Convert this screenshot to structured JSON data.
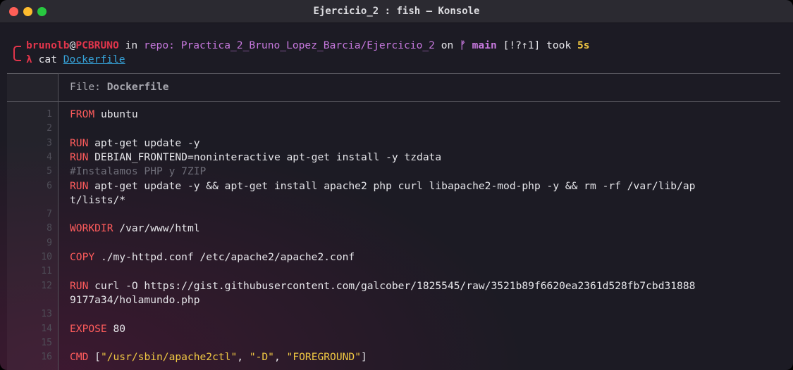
{
  "window": {
    "title": "Ejercicio_2 : fish — Konsole"
  },
  "prompt": {
    "user": "brunolb",
    "at": "@",
    "host": "PCBRUNO",
    "in_text": " in ",
    "repo": "repo: Practica_2_Bruno_Lopez_Barcia/Ejercicio_2",
    "on_text": " on ",
    "branch": "ᚠ main",
    "git_status": " [!?↑1]",
    "took_text": " took ",
    "duration": "5s",
    "lambda": "λ",
    "command": " cat ",
    "argument": "Dockerfile"
  },
  "file_header": {
    "label": "File: ",
    "name": "Dockerfile"
  },
  "lines": [
    {
      "num": "1",
      "parts": [
        {
          "t": "kw",
          "v": "FROM"
        },
        {
          "t": "txt",
          "v": " ubuntu"
        }
      ]
    },
    {
      "num": "2",
      "parts": []
    },
    {
      "num": "3",
      "parts": [
        {
          "t": "kw",
          "v": "RUN"
        },
        {
          "t": "txt",
          "v": " apt-get update -y"
        }
      ]
    },
    {
      "num": "4",
      "parts": [
        {
          "t": "kw",
          "v": "RUN"
        },
        {
          "t": "txt",
          "v": " DEBIAN_FRONTEND=noninteractive apt-get install -y tzdata"
        }
      ]
    },
    {
      "num": "5",
      "parts": [
        {
          "t": "cm",
          "v": "#Instalamos PHP y 7ZIP"
        }
      ]
    },
    {
      "num": "6",
      "parts": [
        {
          "t": "kw",
          "v": "RUN"
        },
        {
          "t": "txt",
          "v": " apt-get update -y && apt-get install apache2 php curl libapache2-mod-php -y && rm -rf /var/lib/ap"
        }
      ]
    },
    {
      "num": "",
      "parts": [
        {
          "t": "txt",
          "v": "t/lists/*"
        }
      ]
    },
    {
      "num": "7",
      "parts": []
    },
    {
      "num": "8",
      "parts": [
        {
          "t": "kw",
          "v": "WORKDIR"
        },
        {
          "t": "txt",
          "v": " /var/www/html"
        }
      ]
    },
    {
      "num": "9",
      "parts": []
    },
    {
      "num": "10",
      "parts": [
        {
          "t": "kw",
          "v": "COPY"
        },
        {
          "t": "txt",
          "v": " ./my-httpd.conf /etc/apache2/apache2.conf"
        }
      ]
    },
    {
      "num": "11",
      "parts": []
    },
    {
      "num": "12",
      "parts": [
        {
          "t": "kw",
          "v": "RUN"
        },
        {
          "t": "txt",
          "v": " curl -O https://gist.githubusercontent.com/galcober/1825545/raw/3521b89f6620ea2361d528fb7cbd31888"
        }
      ]
    },
    {
      "num": "",
      "parts": [
        {
          "t": "txt",
          "v": "9177a34/holamundo.php"
        }
      ]
    },
    {
      "num": "13",
      "parts": []
    },
    {
      "num": "14",
      "parts": [
        {
          "t": "kw",
          "v": "EXPOSE"
        },
        {
          "t": "txt",
          "v": " 80"
        }
      ]
    },
    {
      "num": "15",
      "parts": []
    },
    {
      "num": "16",
      "parts": [
        {
          "t": "kw",
          "v": "CMD"
        },
        {
          "t": "txt",
          "v": " ["
        },
        {
          "t": "str",
          "v": "\"/usr/sbin/apache2ctl\""
        },
        {
          "t": "txt",
          "v": ", "
        },
        {
          "t": "str",
          "v": "\"-D\""
        },
        {
          "t": "txt",
          "v": ", "
        },
        {
          "t": "str",
          "v": "\"FOREGROUND\""
        },
        {
          "t": "txt",
          "v": "]"
        }
      ]
    }
  ],
  "colors": {
    "keyword": "#ff5c5c",
    "comment": "#6e6d78",
    "string": "#f0c843",
    "prompt_user": "#e0354b",
    "repo": "#c678dd",
    "link": "#36a3d9"
  }
}
